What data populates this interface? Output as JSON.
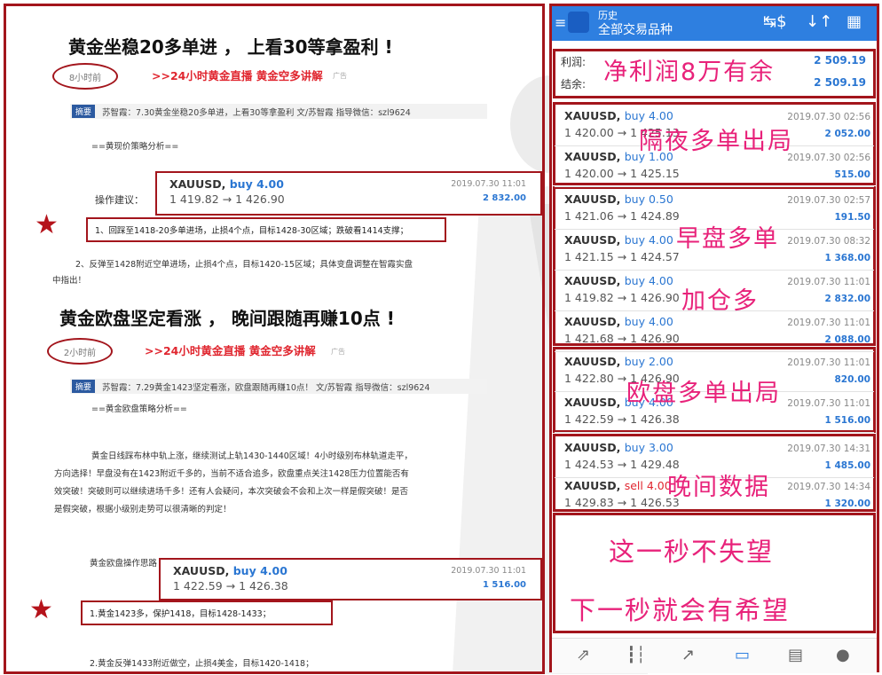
{
  "article": {
    "post1": {
      "headline": "黄金坐稳20多单进 ， 上看30等拿盈利 !",
      "time": "8小时前",
      "promo": ">>24小时黄金直播 黄金空多讲解",
      "ad_label": "广告",
      "summary_tag": "摘要",
      "summary_text": "苏智霞：7.30黄金坐稳20多单进，上看30等拿盈利 文/苏智霞 指导微信：szl9624",
      "analysis_title": "==黄现价策略分析==",
      "strategy_label": "操作建议：",
      "card": {
        "symbol": "XAUUSD,",
        "side": "buy 4.00",
        "price": "1 419.82 → 1 426.90",
        "date": "2019.07.30 11:01",
        "profit": "2 832.00"
      },
      "step1": "1、回踩至1418-20多单进场，止损4个点，目标1428-30区域；跌破看1414支撑；",
      "step2_line1": "2、反弹至1428附近空单进场，止损4个点，目标1420-15区域；具体变盘调整在智霞实盘",
      "step2_line2": "中指出！"
    },
    "post2": {
      "headline": "黄金欧盘坚定看涨 ， 晚间跟随再赚10点 !",
      "time": "2小时前",
      "promo": ">>24小时黄金直播 黄金空多讲解",
      "ad_label": "广告",
      "summary_tag": "摘要",
      "summary_text": "苏智霞：7.29黄金1423坚定看涨，欧盘跟随再赚10点！ 文/苏智霞 指导微信：szl9624",
      "analysis_title": "==黄金欧盘策略分析==",
      "para": [
        "黄金日线踩布林中轨上涨，继续测试上轨1430-1440区域！4小时级别布林轨道走平，",
        "方向选择！早盘没有在1423附近千多的，当前不适合追多，欧盘重点关注1428压力位置能否有",
        "效突破！突破则可以继续进场千多！还有人会疑问，本次突破会不会和上次一样是假突破！是否",
        "是假突破，根据小级别走势可以很清晰的判定！"
      ],
      "strategy_label": "黄金欧盘操作思路",
      "card": {
        "symbol": "XAUUSD,",
        "side": "buy 4.00",
        "price": "1 422.59 → 1 426.38",
        "date": "2019.07.30 11:01",
        "profit": "1 516.00"
      },
      "step1": "1.黄金1423多，保护1418，目标1428-1433；",
      "step2": "2.黄金反弹1433附近做空，止损4美金，目标1420-1418；"
    }
  },
  "mobile": {
    "header": {
      "subtitle": "历史",
      "title": "全部交易品种"
    },
    "summary": {
      "profit_label": "利润:",
      "profit_value": "2 509.19",
      "balance_label": "结余:",
      "balance_value": "2 509.19"
    },
    "trades": [
      {
        "symbol": "XAUUSD,",
        "side": "buy 4.00",
        "type": "buy",
        "price": "1 420.00 → 1 425.13",
        "date": "2019.07.30 02:56",
        "profit": "2 052.00"
      },
      {
        "symbol": "XAUUSD,",
        "side": "buy 1.00",
        "type": "buy",
        "price": "1 420.00 → 1 425.15",
        "date": "2019.07.30 02:56",
        "profit": "515.00"
      },
      {
        "symbol": "XAUUSD,",
        "side": "buy 0.50",
        "type": "buy",
        "price": "1 421.06 → 1 424.89",
        "date": "2019.07.30 02:57",
        "profit": "191.50"
      },
      {
        "symbol": "XAUUSD,",
        "side": "buy 4.00",
        "type": "buy",
        "price": "1 421.15 → 1 424.57",
        "date": "2019.07.30 08:32",
        "profit": "1 368.00"
      },
      {
        "symbol": "XAUUSD,",
        "side": "buy 4.00",
        "type": "buy",
        "price": "1 419.82 → 1 426.90",
        "date": "2019.07.30 11:01",
        "profit": "2 832.00"
      },
      {
        "symbol": "XAUUSD,",
        "side": "buy 4.00",
        "type": "buy",
        "price": "1 421.68 → 1 426.90",
        "date": "2019.07.30 11:01",
        "profit": "2 088.00"
      },
      {
        "symbol": "XAUUSD,",
        "side": "buy 2.00",
        "type": "buy",
        "price": "1 422.80 → 1 426.90",
        "date": "2019.07.30 11:01",
        "profit": "820.00"
      },
      {
        "symbol": "XAUUSD,",
        "side": "buy 4.00",
        "type": "buy",
        "price": "1 422.59 → 1 426.38",
        "date": "2019.07.30 11:01",
        "profit": "1 516.00"
      },
      {
        "symbol": "XAUUSD,",
        "side": "buy 3.00",
        "type": "buy",
        "price": "1 424.53 → 1 429.48",
        "date": "2019.07.30 14:31",
        "profit": "1 485.00"
      },
      {
        "symbol": "XAUUSD,",
        "side": "sell 4.00",
        "type": "sell",
        "price": "1 429.83 → 1 426.53",
        "date": "2019.07.30 14:34",
        "profit": "1 320.00"
      }
    ],
    "overlays": {
      "net_profit": "净利润8万有余",
      "overnight": "隔夜多单出局",
      "morning": "早盘多单",
      "add_position": "加仓多",
      "europe": "欧盘多单出局",
      "evening": "晚间数据",
      "slogan1": "这一秒不失望",
      "slogan2": "下一秒就会有希望"
    },
    "nav": [
      "trade-icon",
      "candles-icon",
      "chart-icon",
      "history-icon",
      "news-icon",
      "chat-icon"
    ]
  },
  "colors": {
    "frame": "#a3151c",
    "accent_blue": "#2e7fe0",
    "overlay_pink": "#e8227a",
    "sell_red": "#e0262f"
  }
}
